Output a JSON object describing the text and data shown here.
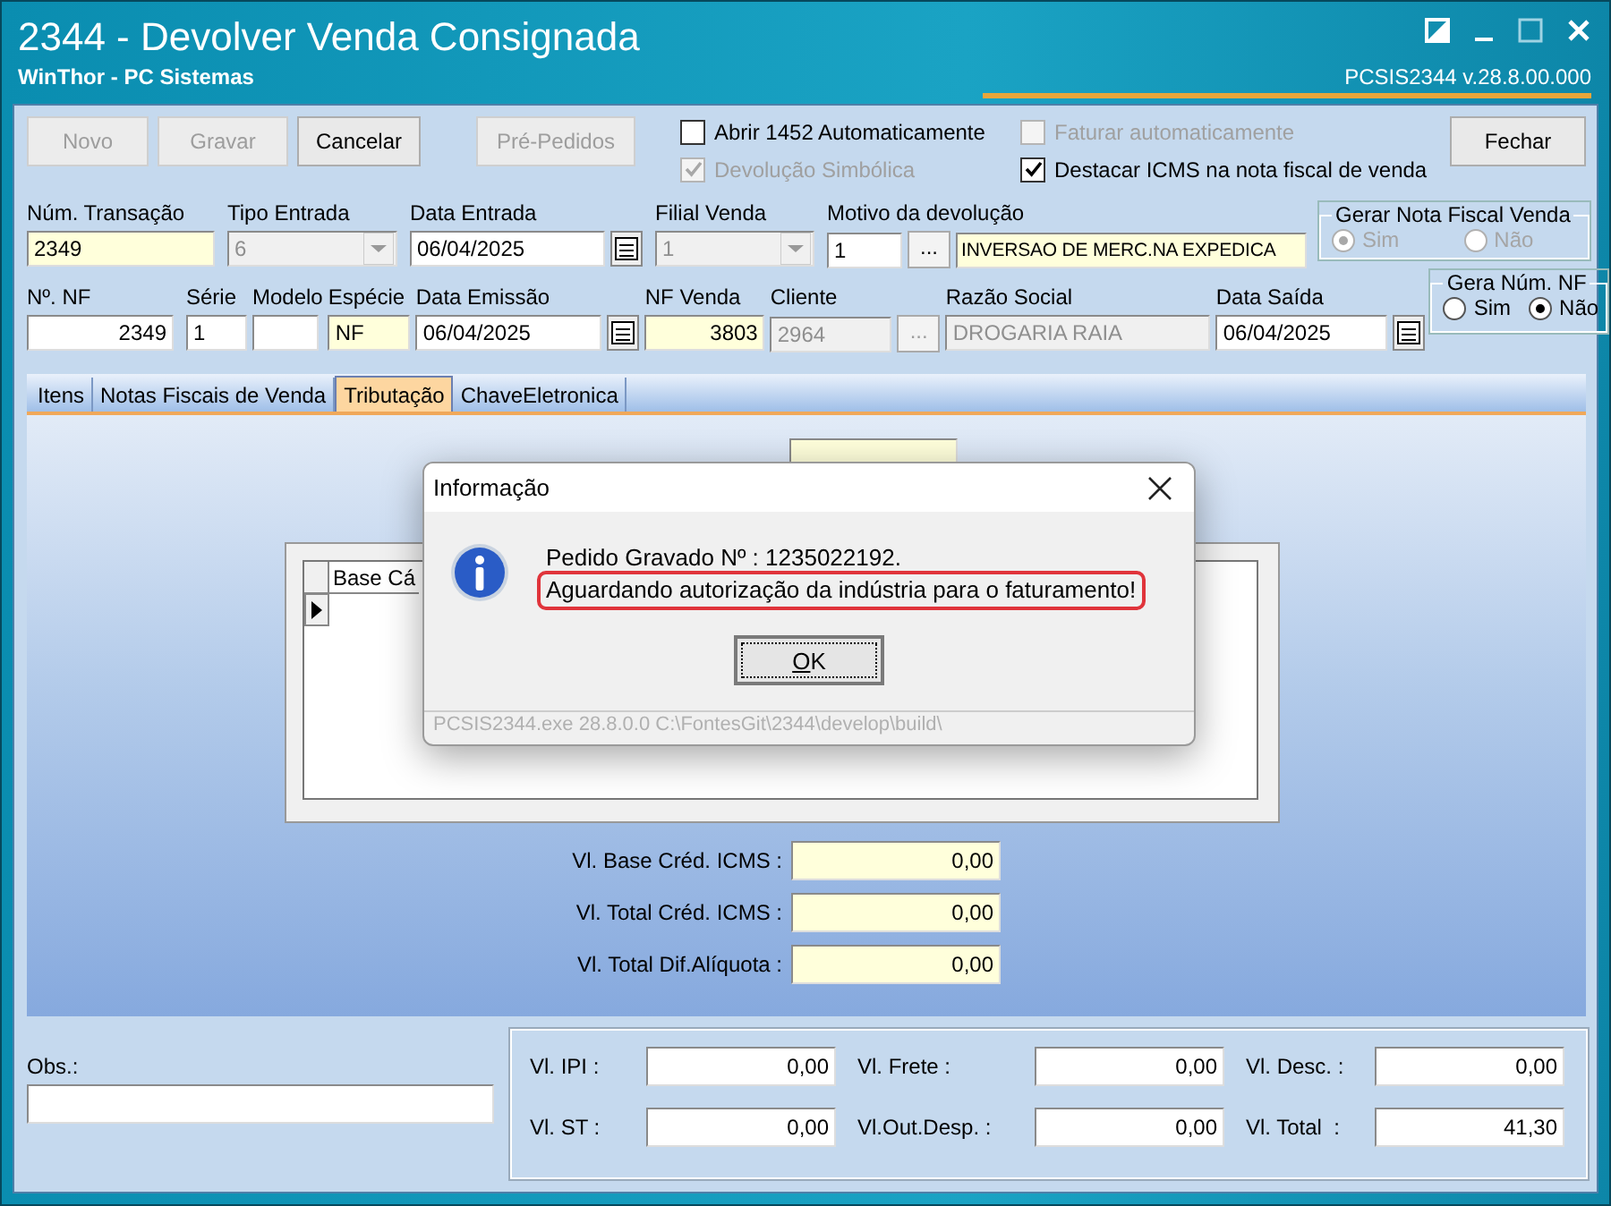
{
  "window": {
    "title": "2344 - Devolver Venda Consignada",
    "subtitle": "WinThor - PC Sistemas",
    "version": "PCSIS2344  v.28.8.00.000"
  },
  "toolbar": {
    "buttons": [
      {
        "label": "Novo",
        "disabled": true
      },
      {
        "label": "Gravar",
        "disabled": true
      },
      {
        "label": "Cancelar",
        "disabled": false
      },
      {
        "label": "Pré-Pedidos",
        "disabled": true
      }
    ],
    "checkboxes": [
      {
        "label": "Abrir 1452 Automaticamente",
        "checked": false,
        "disabled": false
      },
      {
        "label": "Devolução Simbólica",
        "checked": true,
        "disabled": true
      },
      {
        "label": "Faturar automaticamente",
        "checked": false,
        "disabled": true
      },
      {
        "label": "Destacar ICMS na nota fiscal de venda",
        "checked": true,
        "disabled": false
      }
    ],
    "close_button": "Fechar"
  },
  "row_1": [
    {
      "kind": "text",
      "label": "Núm. Transação",
      "value": "2349",
      "required": true,
      "disabled": false
    },
    {
      "kind": "select",
      "label": "Tipo Entrada",
      "value": "6",
      "required": false,
      "disabled": true
    },
    {
      "kind": "date",
      "label": "Data Entrada",
      "value": "06/04/2025",
      "required": false,
      "disabled": false
    },
    {
      "kind": "select",
      "label": "Filial Venda",
      "value": "1",
      "required": false,
      "disabled": true
    },
    {
      "kind": "lookup",
      "label": "Motivo da devolução",
      "value": "1",
      "button": "...",
      "description": "INVERSAO DE MERC.NA EXPEDICA",
      "required": true,
      "disabled": false
    }
  ],
  "gerar_nota_fiscal_venda": {
    "title": "Gerar Nota Fiscal Venda",
    "options": [
      {
        "label": "Sim",
        "selected": true,
        "disabled": true
      },
      {
        "label": "Não",
        "selected": false,
        "disabled": true
      }
    ]
  },
  "row_2": [
    {
      "kind": "text",
      "label": "Nº. NF",
      "value": "2349",
      "required": false,
      "disabled": false
    },
    {
      "kind": "text",
      "label": "Série",
      "value": "1",
      "required": false,
      "disabled": false
    },
    {
      "kind": "text",
      "label": "Modelo",
      "required": false,
      "disabled": false
    },
    {
      "kind": "text",
      "label": "Espécie",
      "value": "NF",
      "required": true,
      "disabled": false
    },
    {
      "kind": "date",
      "label": "Data Emissão",
      "value": "06/04/2025",
      "required": false,
      "disabled": false
    },
    {
      "kind": "text",
      "label": "NF Venda",
      "value": "3803",
      "required": true,
      "disabled": false
    },
    {
      "kind": "lookup",
      "label": "Cliente",
      "value": "2964",
      "button": "...",
      "required": false,
      "disabled": true
    },
    {
      "kind": "text",
      "label": "Razão Social",
      "value": "DROGARIA RAIA",
      "required": false,
      "disabled": true
    },
    {
      "kind": "date",
      "label": "Data Saída",
      "value": "06/04/2025",
      "required": false,
      "disabled": false
    }
  ],
  "gera_num_nf": {
    "title": "Gera Núm. NF",
    "options": [
      {
        "label": "Sim",
        "selected": false,
        "disabled": false
      },
      {
        "label": "Não",
        "selected": true,
        "disabled": false
      }
    ]
  },
  "tabs": [
    {
      "label": "Itens",
      "selected": false
    },
    {
      "label": "Notas Fiscais de Venda",
      "selected": false
    },
    {
      "label": "Tributação",
      "selected": true
    },
    {
      "label": "ChaveEletronica",
      "selected": false
    }
  ],
  "grid": {
    "columns": [
      "Base Cá"
    ]
  },
  "totals": [
    {
      "label": "Vl. Base Créd. ICMS :",
      "value": "0,00"
    },
    {
      "label": "Vl. Total Créd. ICMS :",
      "value": "0,00"
    },
    {
      "label": "Vl. Total Dif.Alíquota :",
      "value": "0,00"
    }
  ],
  "obs": {
    "label": "Obs.:"
  },
  "summary": [
    {
      "label": "Vl. IPI :",
      "value": "0,00"
    },
    {
      "label": "Vl. Frete :",
      "value": "0,00"
    },
    {
      "label": "Vl. Desc. :",
      "value": "0,00"
    },
    {
      "label": "Vl. ST :",
      "value": "0,00"
    },
    {
      "label": "Vl.Out.Desp. :",
      "value": "0,00"
    },
    {
      "label": "Vl. Total  :",
      "value": "41,30"
    }
  ],
  "dialog": {
    "title": "Informação",
    "lines": [
      {
        "text": "Pedido Gravado Nº : 1235022192.",
        "highlighted": false
      },
      {
        "text": "Aguardando autorização da indústria para o faturamento!",
        "highlighted": true
      }
    ],
    "button": "OK",
    "footer": "PCSIS2344.exe 28.8.0.0 C:\\FontesGit\\2344\\develop\\build\\"
  }
}
